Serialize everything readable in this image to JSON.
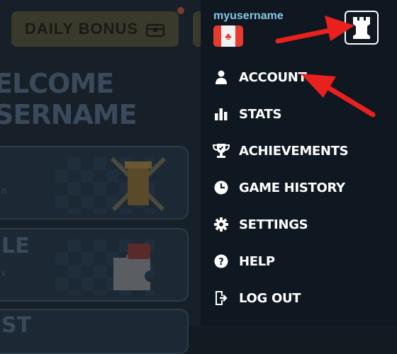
{
  "header": {
    "daily_bonus_label": "DAILY BONUS"
  },
  "welcome": {
    "line1": "ELCOME",
    "line2": "SERNAME"
  },
  "cards": [
    {
      "title": "",
      "subtitle": "n"
    },
    {
      "title": "LE",
      "subtitle": "s"
    },
    {
      "title": "ST",
      "subtitle": ""
    }
  ],
  "menu": {
    "username": "myusername",
    "flag_icon": "canada-flag",
    "avatar_icon": "chess-rook-icon",
    "items": [
      {
        "label": "ACCOUNT",
        "icon": "user-icon"
      },
      {
        "label": "STATS",
        "icon": "bar-chart-icon"
      },
      {
        "label": "ACHIEVEMENTS",
        "icon": "trophy-icon"
      },
      {
        "label": "GAME HISTORY",
        "icon": "clock-icon"
      },
      {
        "label": "SETTINGS",
        "icon": "gear-icon"
      },
      {
        "label": "HELP",
        "icon": "help-icon"
      },
      {
        "label": "LOG OUT",
        "icon": "logout-icon"
      }
    ]
  },
  "colors": {
    "menu_bg": "#0f1721",
    "username": "#84c8e8",
    "arrow": "#e8211e",
    "page_bg": "#172029"
  }
}
